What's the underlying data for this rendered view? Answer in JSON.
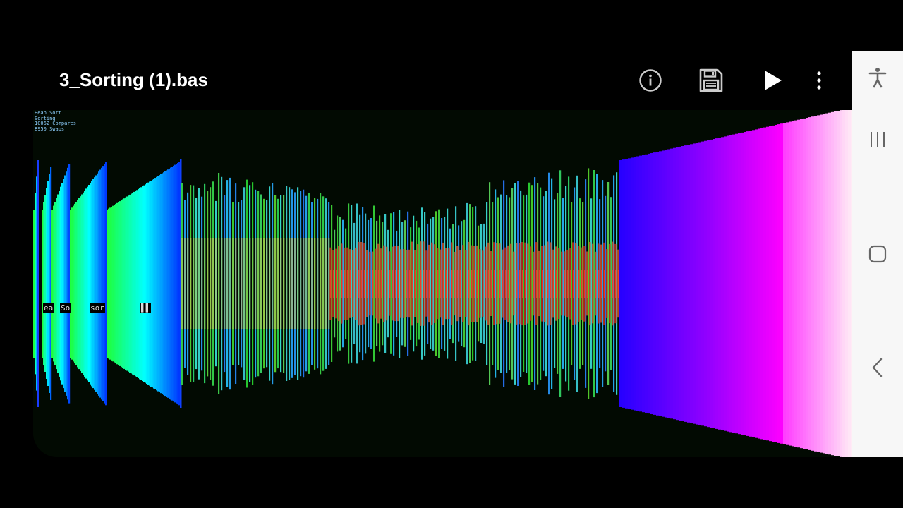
{
  "app_bar": {
    "title": "3_Sorting (1).bas",
    "actions": [
      {
        "name": "info",
        "icon": "info-icon"
      },
      {
        "name": "save",
        "icon": "floppy-disk-icon"
      },
      {
        "name": "run",
        "icon": "play-icon"
      },
      {
        "name": "more",
        "icon": "more-vertical-icon"
      }
    ]
  },
  "program_output": {
    "stats": [
      "Heap Sort",
      "Sorting",
      "10062 Compares",
      "8950 Swaps"
    ],
    "overlay_fragments": [
      "ea",
      "So",
      "sor",
      "▌▌"
    ]
  },
  "nav_bar": {
    "buttons": [
      {
        "name": "accessibility",
        "icon": "accessibility-icon"
      },
      {
        "name": "recent-apps",
        "icon": "recent-apps-icon"
      },
      {
        "name": "home",
        "icon": "home-icon"
      },
      {
        "name": "back",
        "icon": "back-icon"
      }
    ]
  },
  "colors": {
    "background": "#000000",
    "canvas_background": "#020a02",
    "nav_background": "#f7f7f7",
    "icon_light": "#ffffff",
    "icon_muted": "#cccccc",
    "nav_icon": "#666666"
  }
}
